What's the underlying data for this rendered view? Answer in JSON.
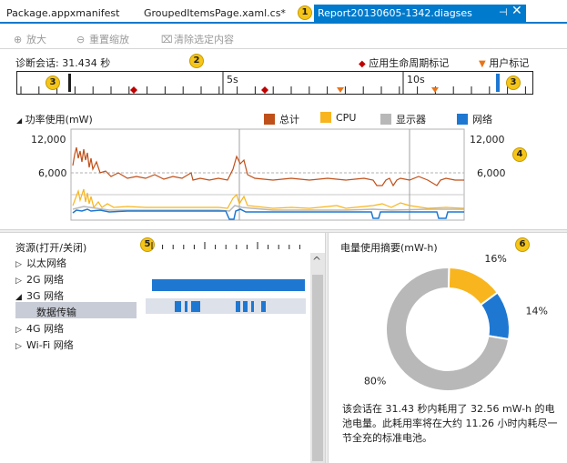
{
  "tabs": [
    {
      "label": "Package.appxmanifest"
    },
    {
      "label": "GroupedItemsPage.xaml.cs*"
    },
    {
      "label": "Report20130605-1342.diagses"
    }
  ],
  "tab_pin_icon": "pin-icon",
  "tab_close": "✕",
  "callouts": [
    "1",
    "2",
    "3",
    "4",
    "5",
    "6"
  ],
  "toolbar": {
    "zoom_in": "放大",
    "reset_zoom": "重置缩放",
    "clear_selection": "清除选定内容"
  },
  "session": {
    "label": "诊断会话: 31.434 秒",
    "legend_lifecycle": "应用生命周期标记",
    "legend_user": "用户标记"
  },
  "ruler": {
    "labels": [
      "5s",
      "10s"
    ],
    "lifecycle_color": "#c00000",
    "user_color": "#e8741a"
  },
  "power": {
    "title": "功率使用(mW)",
    "legend": [
      {
        "name": "总计",
        "color": "#c0501a"
      },
      {
        "name": "CPU",
        "color": "#f8b51e"
      },
      {
        "name": "显示器",
        "color": "#b8b8b8"
      },
      {
        "name": "网络",
        "color": "#1e78d2"
      }
    ],
    "y_ticks": [
      "12,000",
      "6,000"
    ]
  },
  "resources": {
    "title": "资源(打开/关闭)",
    "items": [
      {
        "label": "以太网络",
        "expanded": false
      },
      {
        "label": "2G 网络",
        "expanded": false
      },
      {
        "label": "3G 网络",
        "expanded": true
      },
      {
        "label": "数据传输",
        "child": true,
        "selected": true
      },
      {
        "label": "4G 网络",
        "expanded": false
      },
      {
        "label": "Wi-Fi 网络",
        "expanded": false
      }
    ],
    "bar_color": "#1e78d2"
  },
  "energy": {
    "title": "电量使用摘要(mW-h)",
    "summary": "该会话在 31.43 秒内耗用了 32.56 mW-h 的电池电量。此耗用率将在大约 11.26 小时内耗尽一节全充的标准电池。",
    "chart_data": {
      "type": "pie",
      "categories": [
        "CPU",
        "网络",
        "显示器"
      ],
      "values": [
        16,
        14,
        80
      ],
      "labels": [
        "16%",
        "14%",
        "80%"
      ],
      "colors": [
        "#f8b51e",
        "#1e78d2",
        "#b8b8b8"
      ]
    }
  }
}
